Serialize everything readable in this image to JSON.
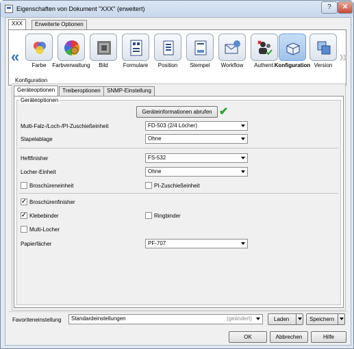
{
  "window": {
    "title": "Eigenschaften von Dokument \"XXX\" (erweitert)",
    "help": "?",
    "close": "✕"
  },
  "tabs": [
    "XXX",
    "Erweiterte Optionen"
  ],
  "toolbar": {
    "left_arrow": "«",
    "right_arrow": "»",
    "items": [
      {
        "label": "Farbe",
        "icon": "color-circles-icon"
      },
      {
        "label": "Farbverwaltung",
        "icon": "color-wheel-gear-icon"
      },
      {
        "label": "Bild",
        "icon": "image-icon"
      },
      {
        "label": "Formulare",
        "icon": "forms-icon"
      },
      {
        "label": "Position",
        "icon": "position-document-icon"
      },
      {
        "label": "Stempel",
        "icon": "stamp-document-icon"
      },
      {
        "label": "Workflow",
        "icon": "workflow-envelope-icon"
      },
      {
        "label": "Authent.",
        "icon": "authentication-users-icon"
      },
      {
        "label": "Konfiguration",
        "icon": "configuration-device-icon",
        "selected": true
      },
      {
        "label": "Version",
        "icon": "version-icon"
      }
    ]
  },
  "section": {
    "label": "Konfiguration"
  },
  "subtabs": [
    "Geräteoptionen",
    "Treiberoptionen",
    "SNMP-Einstellung"
  ],
  "group": {
    "title": "Geräteoptionen",
    "fetch_button": "Geräteinformationen abrufen",
    "fields": [
      {
        "label": "Multi-Falz-/Loch-/PI-Zuschießeinheit",
        "value": "FD-503 (2/4 Löcher)"
      },
      {
        "label": "Stapelablage",
        "value": "Ohne"
      },
      {
        "label": "Heftfinisher",
        "value": "FS-532"
      },
      {
        "label": "Locher-Einheit",
        "value": "Ohne"
      },
      {
        "label": "Papierfächer",
        "value": "PF-707"
      }
    ],
    "checkboxes": [
      {
        "label": "Broschüreneinheit",
        "checked": false
      },
      {
        "label": "PI-Zuschießeinheit",
        "checked": false
      },
      {
        "label": "Broschürenfinisher",
        "checked": true
      },
      {
        "label": "Klebebinder",
        "checked": true
      },
      {
        "label": "Ringbinder",
        "checked": false
      },
      {
        "label": "Multi-Locher",
        "checked": false
      }
    ]
  },
  "favorites": {
    "label": "Favoriteneinstellung",
    "value": "Standardeinstellungen",
    "status": "(geändert)",
    "load": "Laden",
    "save": "Speichern"
  },
  "footer": {
    "ok": "OK",
    "cancel": "Abbrechen",
    "help": "Hilfe"
  },
  "colors": {
    "selected_tile": "#9fc2ea",
    "check_green": "#2ea12e",
    "accent": "#3a6fc4"
  }
}
